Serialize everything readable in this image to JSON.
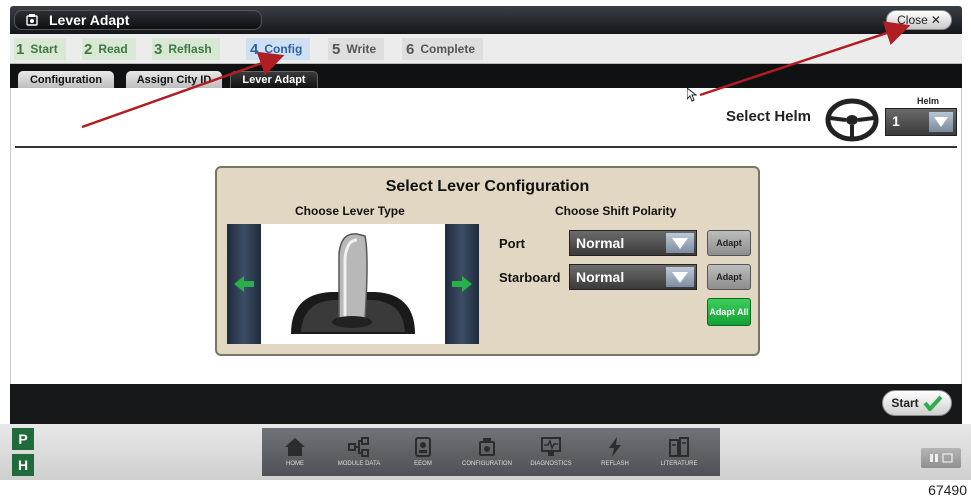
{
  "window": {
    "title": "Lever Adapt",
    "close_label": "Close"
  },
  "steps": [
    {
      "num": "1",
      "label": "Start",
      "state": "done"
    },
    {
      "num": "2",
      "label": "Read",
      "state": "done"
    },
    {
      "num": "3",
      "label": "Reflash",
      "state": "done"
    },
    {
      "num": "4",
      "label": "Config",
      "state": "active"
    },
    {
      "num": "5",
      "label": "Write",
      "state": "pending"
    },
    {
      "num": "6",
      "label": "Complete",
      "state": "pending"
    }
  ],
  "tabs": [
    {
      "label": "Configuration",
      "active": false
    },
    {
      "label": "Assign City ID",
      "active": false
    },
    {
      "label": "Lever Adapt",
      "active": true
    }
  ],
  "helm": {
    "select_label": "Select Helm",
    "caption": "Helm",
    "value": "1"
  },
  "lever": {
    "title": "Select Lever Configuration",
    "choose_type": "Choose Lever Type",
    "choose_polarity": "Choose Shift Polarity",
    "port_label": "Port",
    "port_value": "Normal",
    "starboard_label": "Starboard",
    "starboard_value": "Normal",
    "adapt_label": "Adapt",
    "adapt_all_label": "Adapt All"
  },
  "start_label": "Start",
  "gear": {
    "p": "P",
    "h": "H"
  },
  "nav": [
    {
      "label": "HOME",
      "icon": "home-icon"
    },
    {
      "label": "MODULE DATA",
      "icon": "module-data-icon"
    },
    {
      "label": "EEOM",
      "icon": "eeom-icon"
    },
    {
      "label": "CONFIGURATION",
      "icon": "configuration-icon"
    },
    {
      "label": "DIAGNOSTICS",
      "icon": "diagnostics-icon"
    },
    {
      "label": "REFLASH",
      "icon": "reflash-icon"
    },
    {
      "label": "LITERATURE",
      "icon": "literature-icon"
    }
  ],
  "figure_number": "67490",
  "colors": {
    "accent_green": "#3c7a3c",
    "active_blue": "#2a63a8",
    "arrow_red": "#b01e23"
  }
}
